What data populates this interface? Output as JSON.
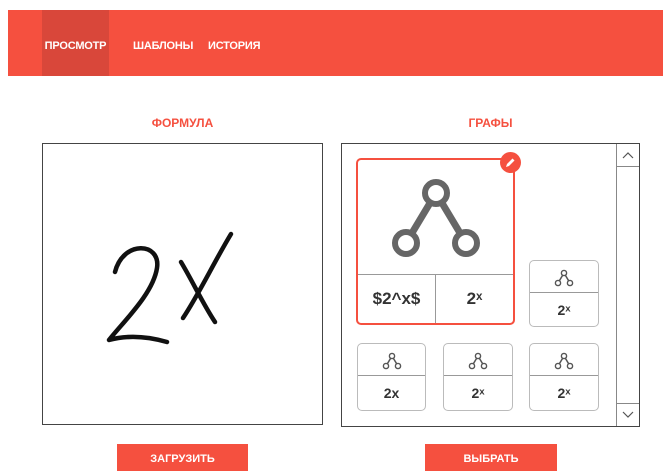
{
  "nav": {
    "items": [
      {
        "label": "ПРОСМОТР",
        "active": true
      },
      {
        "label": "ШАБЛОНЫ",
        "active": false
      },
      {
        "label": "ИСТОРИЯ",
        "active": false
      }
    ]
  },
  "formula": {
    "title": "ФОРМУЛА",
    "handwriting": "2X",
    "upload_label": "ЗАГРУЗИТЬ"
  },
  "graphs": {
    "title": "ГРАФЫ",
    "select_label": "ВЫБРАТЬ",
    "cards": [
      {
        "left_label": "$2^x$",
        "right_label": "2ˣ",
        "selected": true
      },
      {
        "label": "2ˣ"
      },
      {
        "label": "2x"
      },
      {
        "label": "2ˣ"
      },
      {
        "label": "2ˣ"
      }
    ]
  },
  "icons": {
    "graph": "tree-graph-icon",
    "edit": "pencil-icon",
    "scroll_up": "chevron-up-icon",
    "scroll_down": "chevron-down-icon"
  },
  "colors": {
    "accent": "#f5503f",
    "accent_dark": "#d9473a"
  }
}
